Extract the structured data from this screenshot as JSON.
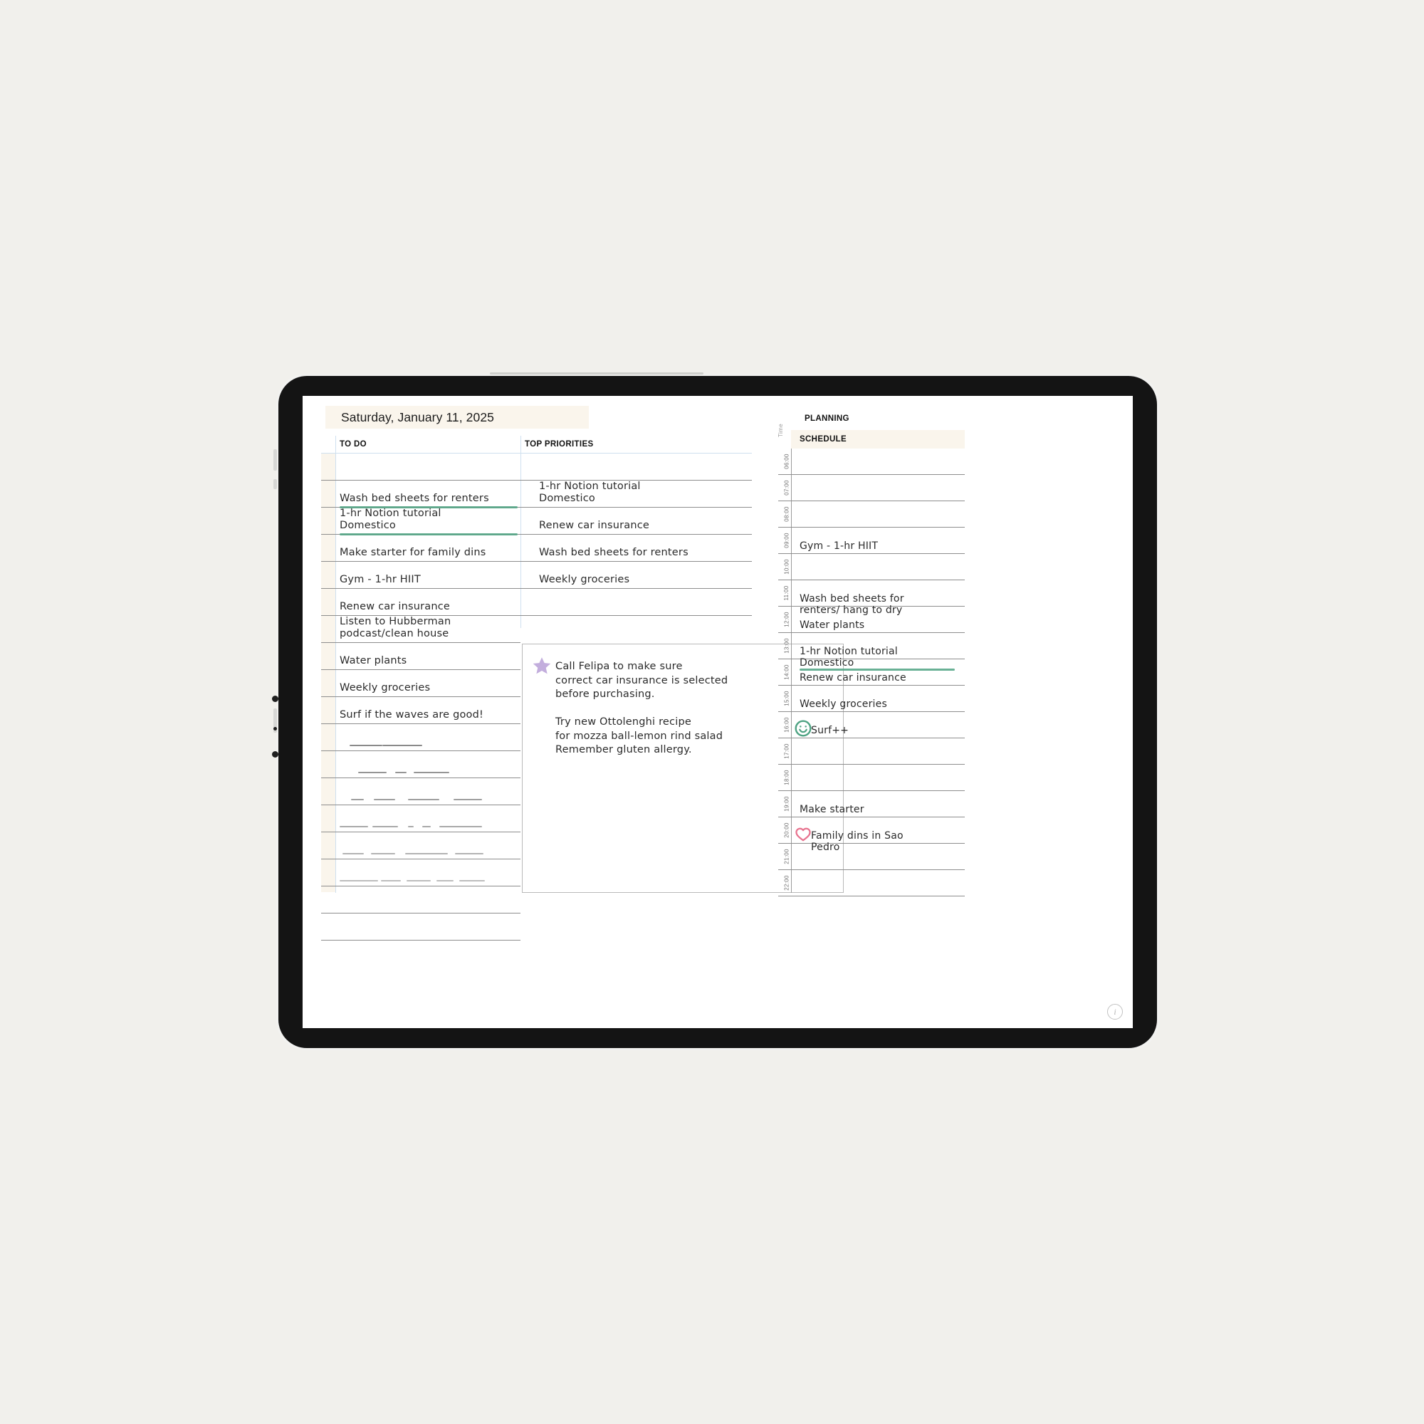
{
  "date_banner": "Saturday, January 11, 2025",
  "headings": {
    "todo": "TO DO",
    "top_priorities": "TOP PRIORITIES",
    "planning": "PLANNING",
    "schedule": "SCHEDULE",
    "time_axis": "Time"
  },
  "colors": {
    "highlighter_green": "#4fa383",
    "star_purple": "#c3aedd",
    "heart_pink": "#e8738f",
    "smiley_green": "#4fa383",
    "banner_cream": "#faf5ec",
    "rule_blue": "#cfe0ef"
  },
  "todo": {
    "items": [
      {
        "text": "",
        "highlighted": false
      },
      {
        "text": "Wash bed sheets for renters",
        "highlighted": true
      },
      {
        "text": "1-hr Notion tutorial\nDomestico",
        "highlighted": true
      },
      {
        "text": "Make starter for family dins",
        "highlighted": false
      },
      {
        "text": "Gym - 1-hr HIIT",
        "highlighted": false
      },
      {
        "text": "Renew car insurance",
        "highlighted": false
      },
      {
        "text": "Listen to Hubberman\npodcast/clean house",
        "highlighted": false
      },
      {
        "text": "Water plants",
        "highlighted": false
      },
      {
        "text": "Weekly groceries",
        "highlighted": false
      },
      {
        "text": "Surf if the waves are good!",
        "highlighted": false
      }
    ]
  },
  "top_priorities": {
    "items": [
      {
        "text": "",
        "highlighted": false
      },
      {
        "text": "1-hr Notion tutorial\nDomestico",
        "highlighted": false
      },
      {
        "text": "Renew car insurance",
        "highlighted": false
      },
      {
        "text": "Wash bed sheets for renters",
        "highlighted": false
      },
      {
        "text": "Weekly groceries",
        "highlighted": false
      },
      {
        "text": "",
        "highlighted": false
      }
    ]
  },
  "notes": {
    "icon": "star-icon",
    "text": "Call Felipa to make sure\ncorrect car insurance is selected\nbefore purchasing.\n\nTry new Ottolenghi recipe\nfor mozza ball-lemon rind salad\nRemember gluten allergy."
  },
  "schedule": {
    "rows": [
      {
        "time": "06:00",
        "text": "",
        "icon": null,
        "highlighted": false
      },
      {
        "time": "07:00",
        "text": "",
        "icon": null,
        "highlighted": false
      },
      {
        "time": "08:00",
        "text": "",
        "icon": null,
        "highlighted": false
      },
      {
        "time": "09:00",
        "text": "Gym - 1-hr HIIT",
        "icon": null,
        "highlighted": false
      },
      {
        "time": "10:00",
        "text": "",
        "icon": null,
        "highlighted": false
      },
      {
        "time": "11:00",
        "text": "Wash bed sheets for\nrenters/ hang to dry",
        "icon": null,
        "highlighted": false
      },
      {
        "time": "12:00",
        "text": "Water plants",
        "icon": null,
        "highlighted": false
      },
      {
        "time": "13:00",
        "text": "1-hr Notion tutorial\nDomestico",
        "icon": null,
        "highlighted": true
      },
      {
        "time": "14:00",
        "text": "Renew car insurance",
        "icon": null,
        "highlighted": false
      },
      {
        "time": "15:00",
        "text": "Weekly groceries",
        "icon": null,
        "highlighted": false
      },
      {
        "time": "16:00",
        "text": "Surf++",
        "icon": "smiley-icon",
        "highlighted": false
      },
      {
        "time": "17:00",
        "text": "",
        "icon": null,
        "highlighted": false
      },
      {
        "time": "18:00",
        "text": "",
        "icon": null,
        "highlighted": false
      },
      {
        "time": "19:00",
        "text": "Make starter",
        "icon": null,
        "highlighted": false
      },
      {
        "time": "20:00",
        "text": "Family dins in Sao\nPedro",
        "icon": "heart-icon",
        "highlighted": false
      },
      {
        "time": "21:00",
        "text": "",
        "icon": null,
        "highlighted": false
      },
      {
        "time": "22:00",
        "text": "",
        "icon": null,
        "highlighted": false
      }
    ]
  },
  "info_button_label": "i"
}
